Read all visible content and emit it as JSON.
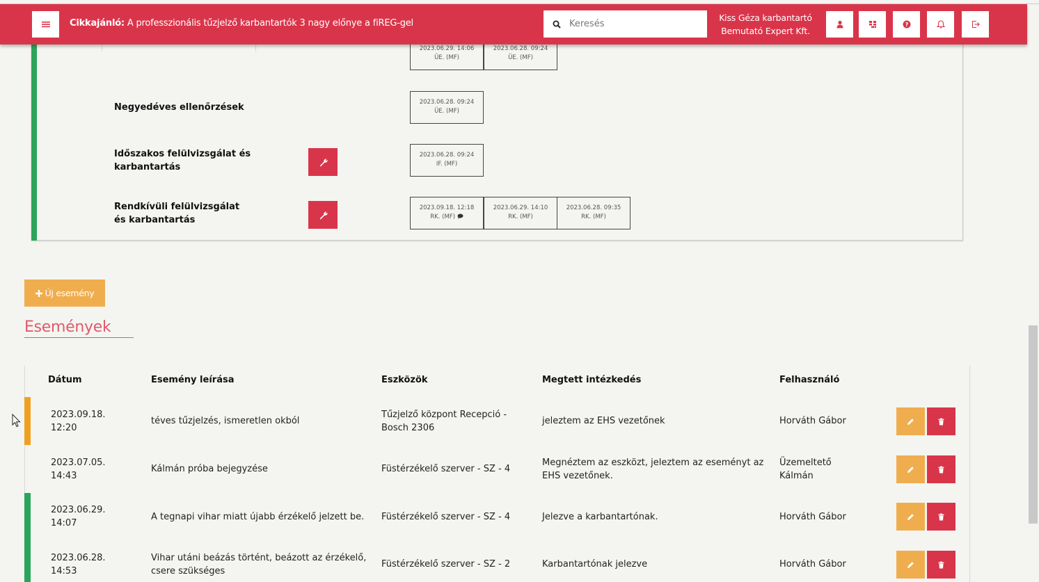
{
  "header": {
    "title_prefix": "Cikkajánló:",
    "title_text": " A professzionális tűzjelző karbantartók 3 nagy előnye a fiREG-gel",
    "search_placeholder": "Keresés",
    "user_name": "Kiss Géza karbantartó",
    "company": "Bemutató Expert Kft."
  },
  "panel": {
    "rows": [
      {
        "label": "",
        "chips": [
          {
            "date": "2023.06.29. 14:06",
            "code": "ÜE. (MF)"
          },
          {
            "date": "2023.06.28. 09:24",
            "code": "ÜE. (MF)"
          }
        ]
      },
      {
        "label": "Negyedéves ellenőrzések",
        "chips": [
          {
            "date": "2023.06.28. 09:24",
            "code": "ÜE. (MF)"
          }
        ]
      },
      {
        "label": "Időszakos felülvizsgálat és karbantartás",
        "chips": [
          {
            "date": "2023.06.28. 09:24",
            "code": "IF. (MF)"
          }
        ]
      },
      {
        "label": "Rendkívüli felülvizsgálat és karbantartás",
        "chips": [
          {
            "date": "2023.09.18. 12:18",
            "code": "RK. (MF)"
          },
          {
            "date": "2023.06.29. 14:10",
            "code": "RK. (MF)"
          },
          {
            "date": "2023.06.28. 09:35",
            "code": "RK. (MF)"
          }
        ]
      }
    ]
  },
  "new_event_label": "Új esemény",
  "events_title": "Események",
  "table": {
    "headers": [
      "Dátum",
      "Esemény leírása",
      "Eszközök",
      "Megtett intézkedés",
      "Felhasználó"
    ],
    "rows": [
      {
        "date": "2023.09.18.",
        "time": "12:20",
        "desc": "téves tűzjelzés, ismeretlen okból",
        "device": "Tűzjelző központ Recepció -",
        "device2": "Bosch 2306",
        "action": "jeleztem az EHS vezetőnek",
        "action2": "",
        "user": "Horváth Gábor",
        "user2": "",
        "accent": "#f0a020"
      },
      {
        "date": "2023.07.05.",
        "time": "14:43",
        "desc": "Kálmán próba bejegyzése",
        "device": "Füstérzékelő szerver - SZ - 4",
        "device2": "",
        "action": "Megnéztem az eszközt, jeleztem az eseményt az",
        "action2": "EHS vezetőnek.",
        "user": "Üzemeltető",
        "user2": "Kálmán",
        "accent": ""
      },
      {
        "date": "2023.06.29.",
        "time": "14:07",
        "desc": "A tegnapi vihar miatt újabb érzékelő jelzett be.",
        "device": "Füstérzékelő szerver - SZ - 4",
        "device2": "",
        "action": "Jelezve a karbantartónak.",
        "action2": "",
        "user": "Horváth Gábor",
        "user2": "",
        "accent": "#2aa55a"
      },
      {
        "date": "2023.06.28.",
        "time": "14:53",
        "desc": "Vihar utáni beázás történt, beázott az érzékelő,",
        "desc2": "csere szükséges",
        "device": "Füstérzékelő szerver - SZ - 2",
        "device2": "",
        "action": "Karbantartónak jelezve",
        "action2": "",
        "user": "Horváth Gábor",
        "user2": "",
        "accent": "#2aa55a"
      }
    ]
  },
  "colors": {
    "brand": "#d9354a",
    "warning": "#f0ad4e",
    "success": "#2aa55a"
  }
}
